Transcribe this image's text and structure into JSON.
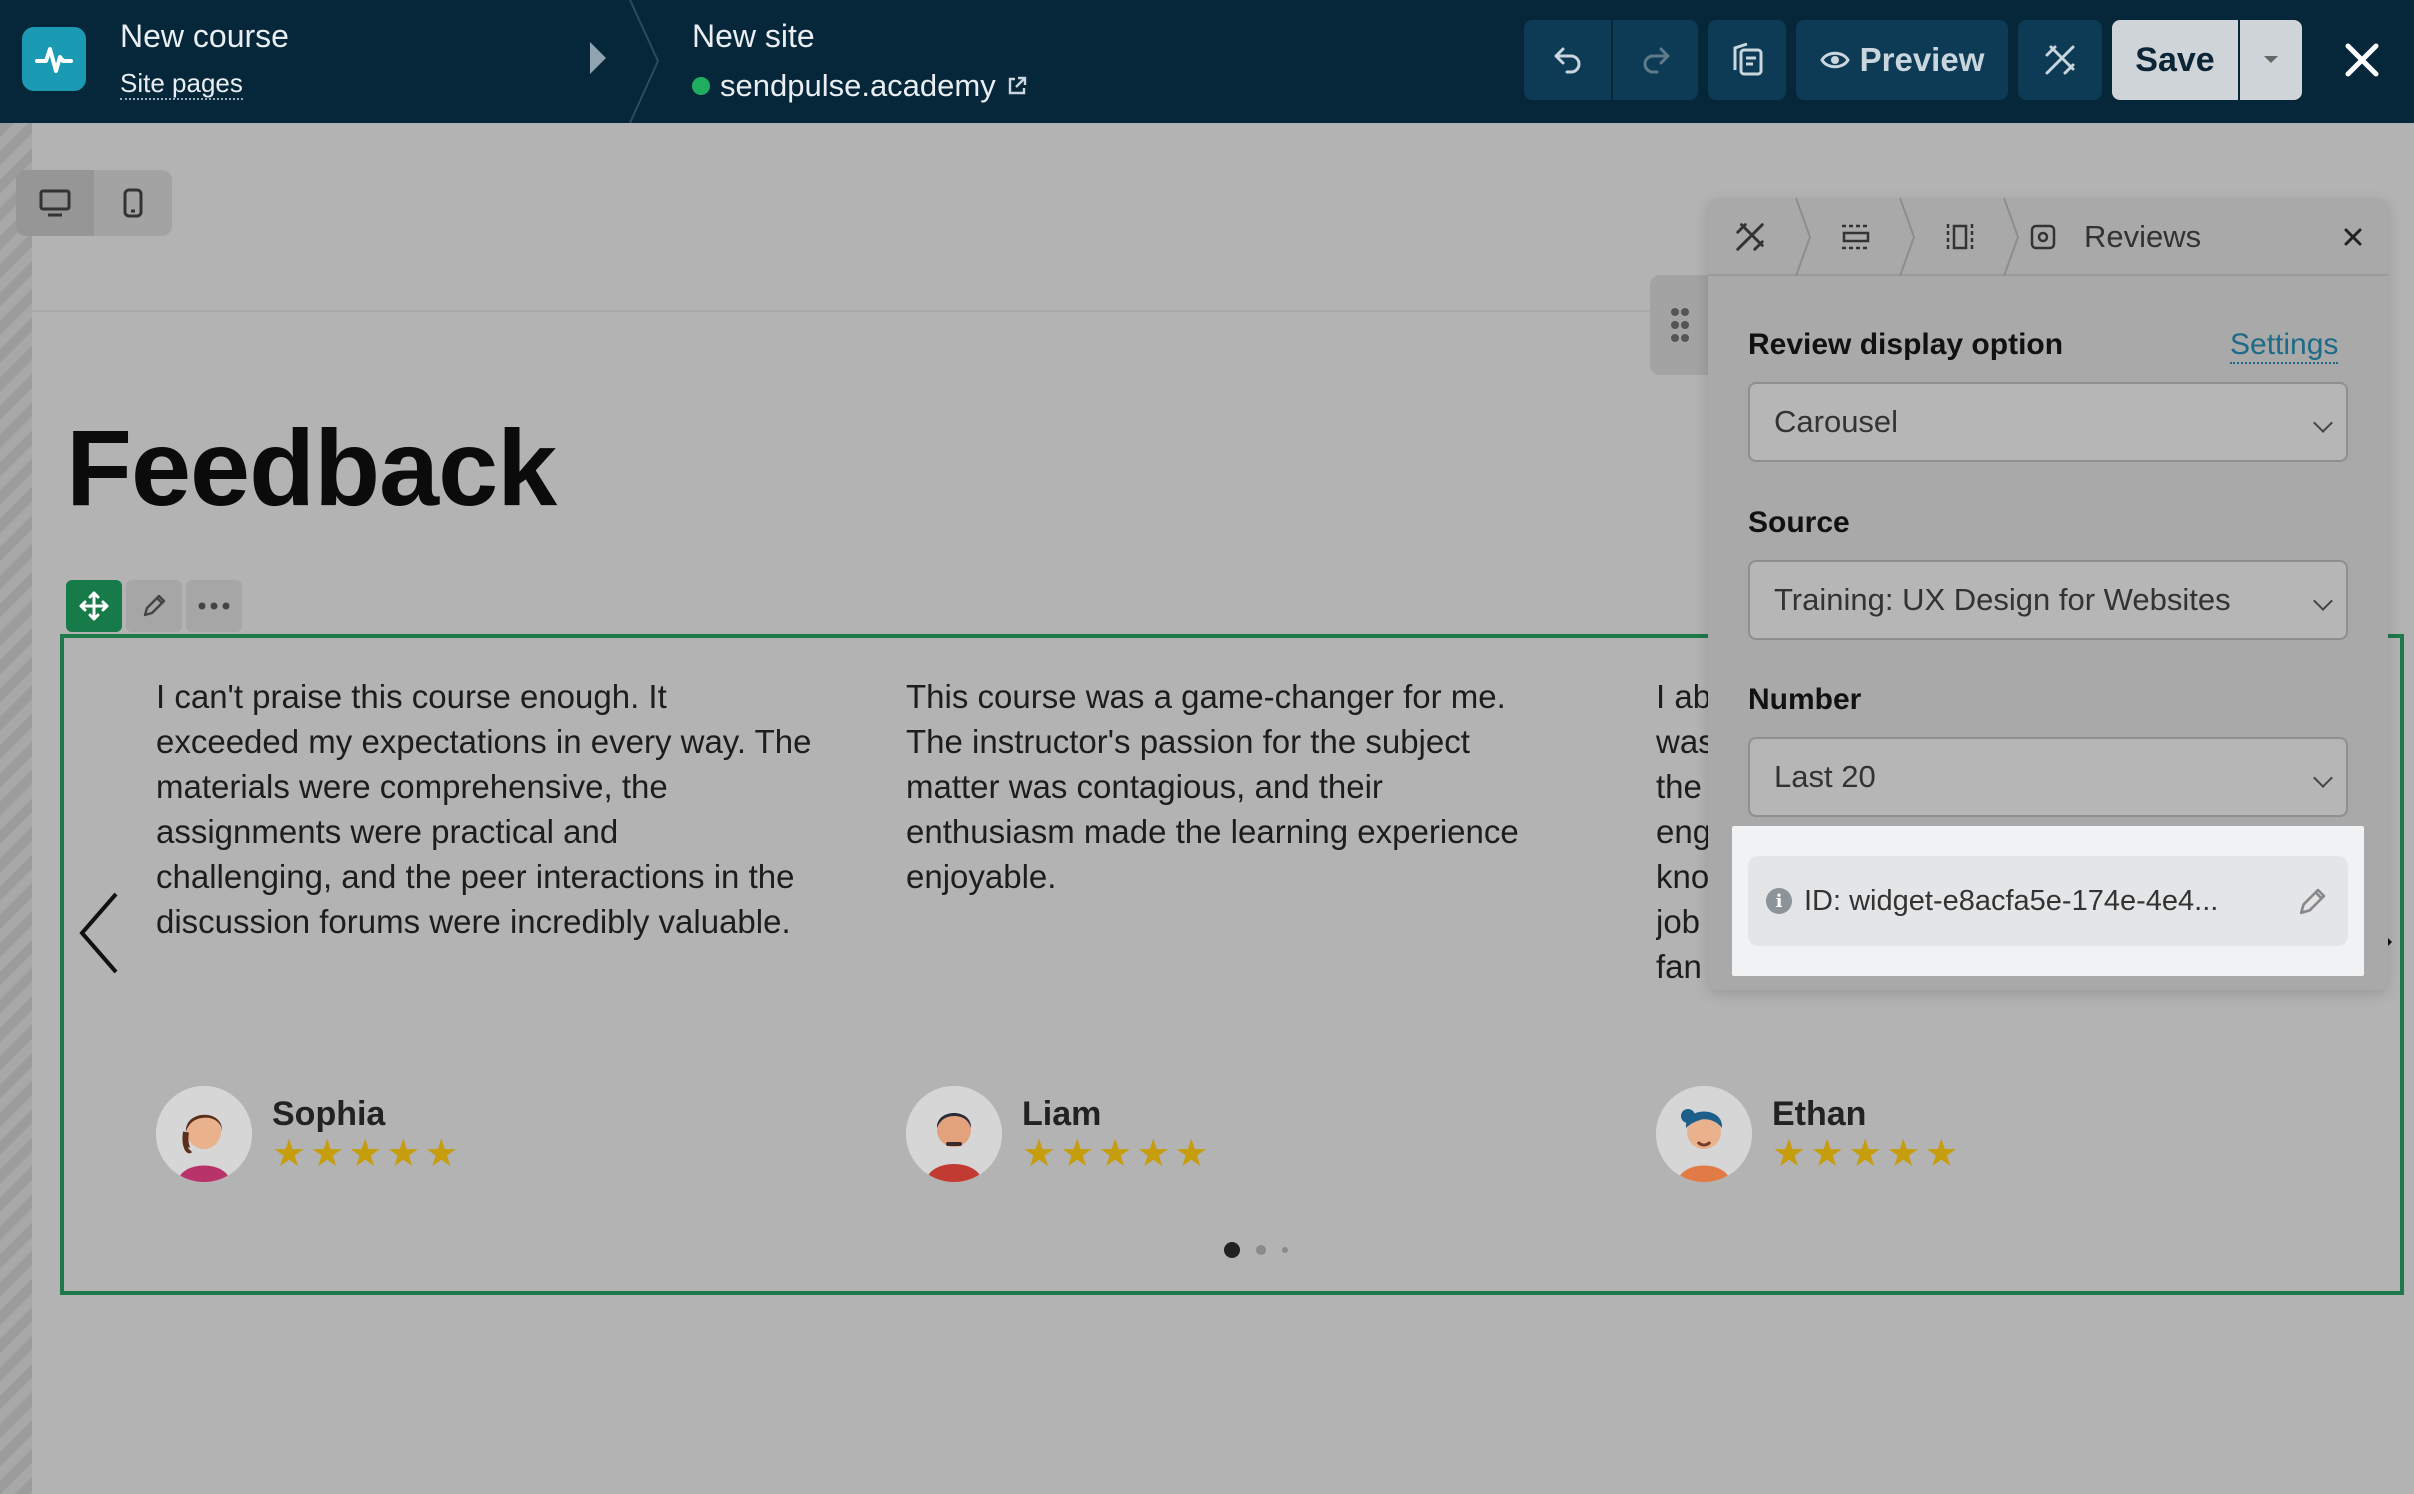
{
  "app": {
    "course_title": "New course",
    "course_sub": "Site pages",
    "site_title": "New site",
    "site_domain": "sendpulse.academy",
    "colors": {
      "topbar": "#06263a",
      "accent": "#1b9ab3",
      "block_border": "#1e7a4b",
      "star": "#c69d0d",
      "status": "#1fae5f"
    }
  },
  "toolbar": {
    "undo_icon": "undo-icon",
    "redo_icon": "redo-icon",
    "pages_icon": "pages-icon",
    "preview_label": "Preview",
    "magic_icon": "magic-wand-icon",
    "save_label": "Save",
    "close_icon": "close-icon"
  },
  "canvas": {
    "device_modes": [
      "desktop",
      "mobile"
    ],
    "heading": "Feedback"
  },
  "reviews": [
    {
      "text_lines": [
        "I can't praise this course enough. It",
        "exceeded my expectations in every way. The",
        "materials were comprehensive, the",
        "assignments were practical and",
        "challenging, and the peer interactions in the",
        "discussion forums were incredibly valuable."
      ],
      "author": "Sophia",
      "rating": 5,
      "stars": "★★★★★"
    },
    {
      "text_lines": [
        "This course was a game-changer for me.",
        "The instructor's passion for the subject",
        "matter was contagious, and their",
        "enthusiasm made the learning experience",
        "enjoyable."
      ],
      "author": "Liam",
      "rating": 5,
      "stars": "★★★★★"
    },
    {
      "text_lines": [
        "I ab",
        "was",
        "the",
        "eng",
        "kno",
        "job",
        "fan"
      ],
      "author": "Ethan",
      "rating": 5,
      "stars": "★★★★★"
    }
  ],
  "carousel": {
    "pages": 3,
    "active_page": 1
  },
  "panel": {
    "title": "Reviews",
    "display_label": "Review display option",
    "settings_link": "Settings",
    "display_value": "Carousel",
    "source_label": "Source",
    "source_value": "Training: UX Design for Websites",
    "number_label": "Number",
    "number_value": "Last 20",
    "id_text": "ID: widget-e8acfa5e-174e-4e4..."
  }
}
